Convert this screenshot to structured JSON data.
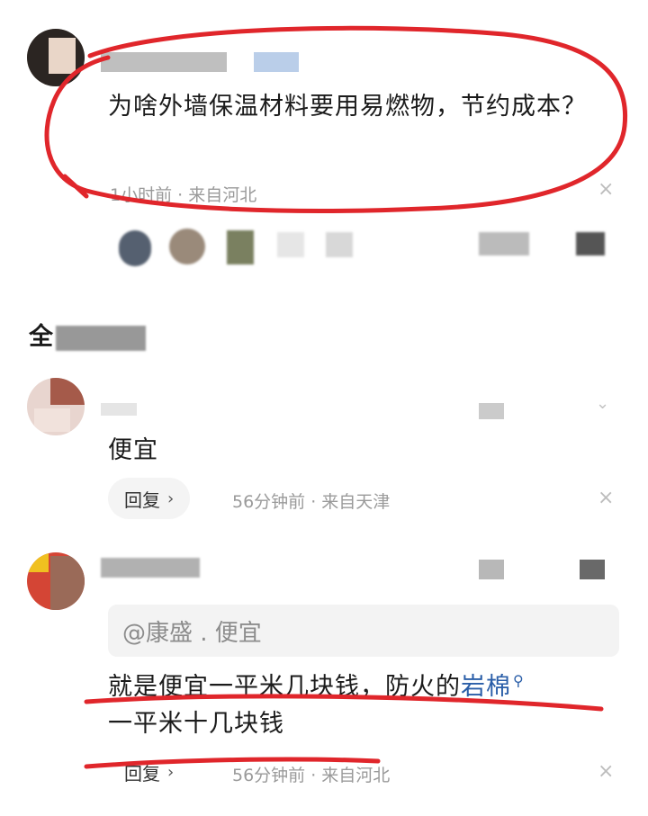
{
  "post": {
    "question": "为啥外墙保温材料要用易燃物，节约成本？",
    "meta": "1小时前 · 来自河北"
  },
  "section": {
    "title_partial": "全"
  },
  "comments": [
    {
      "text": "便宜",
      "reply_label": "回复",
      "meta": "56分钟前 · 来自天津"
    },
    {
      "quote": "@康盛 . 便宜",
      "text_line1_prefix": "就是便宜一平米几块钱，防火的",
      "link_word": "岩棉",
      "text_line2": "一平米十几块钱",
      "reply_label": "回复",
      "meta": "56分钟前 · 来自河北"
    }
  ],
  "icons": {
    "close": "×",
    "chevron": "⌄",
    "reply_arrow": "›"
  },
  "colors": {
    "marker_red": "#e0262b",
    "link_blue": "#2a5ea8"
  }
}
